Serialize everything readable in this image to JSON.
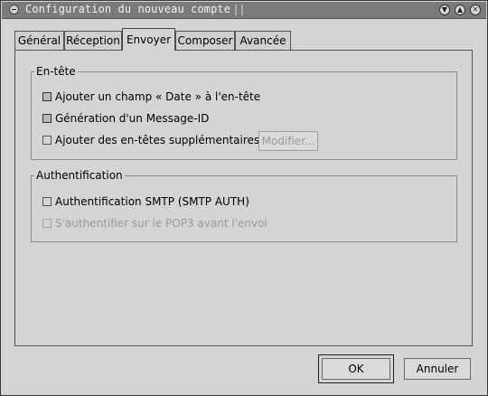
{
  "window": {
    "title": "Configuration du nouveau compte",
    "controls": {
      "minimize": "minimize-icon",
      "maximize": "maximize-icon",
      "close": "close-icon"
    }
  },
  "tabs": [
    {
      "label": "Général",
      "active": false
    },
    {
      "label": "Réception",
      "active": false
    },
    {
      "label": "Envoyer",
      "active": true
    },
    {
      "label": "Composer",
      "active": false
    },
    {
      "label": "Avancée",
      "active": false
    }
  ],
  "header_section": {
    "legend": "En-tête",
    "items": [
      {
        "label": "Ajouter un champ « Date » à l'en-tête",
        "checked": true,
        "enabled": true
      },
      {
        "label": "Génération d'un Message-ID",
        "checked": true,
        "enabled": true
      },
      {
        "label": "Ajouter des en-têtes supplémentaires",
        "checked": false,
        "enabled": true
      }
    ],
    "modify_button": {
      "label": "Modifier...",
      "enabled": false
    }
  },
  "auth_section": {
    "legend": "Authentification",
    "items": [
      {
        "label": "Authentification SMTP (SMTP AUTH)",
        "checked": false,
        "enabled": true
      },
      {
        "label": "S'authentifier sur le POP3 avant l'envoi",
        "checked": false,
        "enabled": false
      }
    ]
  },
  "dialog_buttons": {
    "ok": "OK",
    "cancel": "Annuler"
  }
}
